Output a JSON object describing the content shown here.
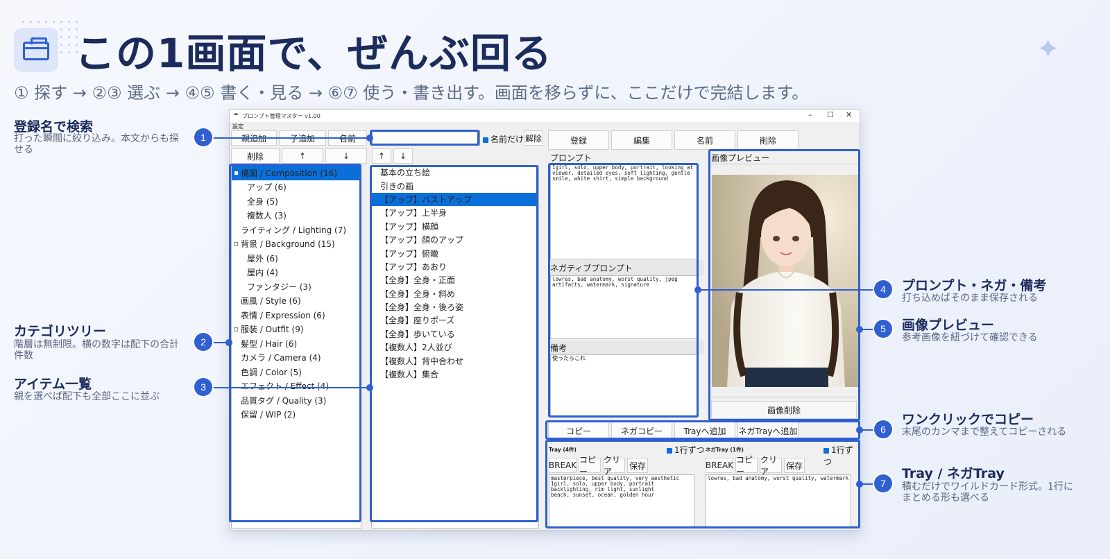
{
  "header": {
    "title": "この1画面で、ぜんぶ回る",
    "subtitle": "① 探す → ②③ 選ぶ → ④⑤ 書く・見る → ⑥⑦ 使う・書き出す。画面を移らずに、ここだけで完結します。"
  },
  "annotations": {
    "left": [
      {
        "num": "1",
        "title": "登録名で検索",
        "desc": "打った瞬間に絞り込み。本文からも探せる"
      },
      {
        "num": "2",
        "title": "カテゴリツリー",
        "desc": "階層は無制限。横の数字は配下の合計件数"
      },
      {
        "num": "3",
        "title": "アイテム一覧",
        "desc": "親を選べば配下も全部ここに並ぶ"
      }
    ],
    "right": [
      {
        "num": "4",
        "title": "プロンプト・ネガ・備考",
        "desc": "打ち込めばそのまま保存される"
      },
      {
        "num": "5",
        "title": "画像プレビュー",
        "desc": "参考画像を紐づけて確認できる"
      },
      {
        "num": "6",
        "title": "ワンクリックでコピー",
        "desc": "末尾のカンマまで整えてコピーされる"
      },
      {
        "num": "7",
        "title": "Tray / ネガTray",
        "desc": "積むだけでワイルドカード形式。1行にまとめる形も選べる"
      }
    ]
  },
  "app": {
    "window_title": "プロンプト管理マスター  v1.00",
    "menu": "設定",
    "window_controls": [
      "–",
      "☐",
      "✕"
    ],
    "toolbar1": [
      "親追加",
      "子追加",
      "名前"
    ],
    "toolbar2": [
      "削除",
      "↑",
      "↓"
    ],
    "list_toolbar": [
      "↑",
      "↓"
    ],
    "search_value": "",
    "name_only_label": "名前だけ",
    "clear_label": "解除",
    "actions": [
      "登録",
      "編集",
      "名前",
      "削除"
    ],
    "tree": [
      {
        "label": "構図 / Composition (16)",
        "level": 0,
        "selected": true,
        "expanded": true
      },
      {
        "label": "アップ (6)",
        "level": 1
      },
      {
        "label": "全身 (5)",
        "level": 1
      },
      {
        "label": "複数人 (3)",
        "level": 1
      },
      {
        "label": "ライティング / Lighting (7)",
        "level": 0
      },
      {
        "label": "背景 / Background (15)",
        "level": 0,
        "expanded": true
      },
      {
        "label": "屋外 (6)",
        "level": 1
      },
      {
        "label": "屋内 (4)",
        "level": 1
      },
      {
        "label": "ファンタジー (3)",
        "level": 1
      },
      {
        "label": "画風 / Style (6)",
        "level": 0
      },
      {
        "label": "表情 / Expression (6)",
        "level": 0
      },
      {
        "label": "服装 / Outfit (9)",
        "level": 0,
        "collapsed": true
      },
      {
        "label": "髪型 / Hair (6)",
        "level": 0
      },
      {
        "label": "カメラ / Camera (4)",
        "level": 0
      },
      {
        "label": "色調 / Color (5)",
        "level": 0
      },
      {
        "label": "エフェクト / Effect (4)",
        "level": 0
      },
      {
        "label": "品質タグ / Quality (3)",
        "level": 0
      },
      {
        "label": "保留 / WIP (2)",
        "level": 0
      }
    ],
    "items": [
      {
        "label": "基本の立ち絵"
      },
      {
        "label": "引きの画"
      },
      {
        "label": "【アップ】バストアップ",
        "selected": true
      },
      {
        "label": "【アップ】上半身"
      },
      {
        "label": "【アップ】横顔"
      },
      {
        "label": "【アップ】顔のアップ"
      },
      {
        "label": "【アップ】俯瞰"
      },
      {
        "label": "【アップ】あおり"
      },
      {
        "label": "【全身】全身・正面"
      },
      {
        "label": "【全身】全身・斜め"
      },
      {
        "label": "【全身】全身・後ろ姿"
      },
      {
        "label": "【全身】座りポーズ"
      },
      {
        "label": "【全身】歩いている"
      },
      {
        "label": "【複数人】2人並び"
      },
      {
        "label": "【複数人】背中合わせ"
      },
      {
        "label": "【複数人】集合"
      }
    ],
    "prompt_label": "プロンプト",
    "prompt_text": "1girl, solo, upper body, portrait, looking at\nviewer, detailed eyes, soft lighting, gentle\nsmile, white shirt, simple background",
    "neg_label": "ネガティブプロンプト",
    "neg_text": "lowres, bad anatomy, worst quality, jpeg\nartifacts, watermark, signature",
    "notes_label": "備考",
    "notes_text": "使ったらこれ",
    "preview_label": "画像プレビュー",
    "delete_image_label": "画像削除",
    "copy_buttons": [
      "コピー",
      "ネガコピー",
      "Trayへ追加",
      "ネガTrayへ追加"
    ],
    "tray": {
      "label": "Tray (4件)",
      "one_line_label": "1行ずつ",
      "buttons": [
        "BREAK",
        "コピー",
        "クリア",
        "保存"
      ],
      "text": "masterpiece, best quality, very aesthetic\n1girl, solo, upper body, portrait\nbacklighting, rim light, sunlight\nbeach, sunset, ocean, golden hour"
    },
    "neg_tray": {
      "label": "ネガTray (1件)",
      "one_line_label": "1行ずつ",
      "buttons": [
        "BREAK",
        "コピー",
        "クリア",
        "保存"
      ],
      "text": "lowres, bad anatomy, worst quality, watermark"
    }
  },
  "colors": {
    "accent": "#2f5fd0",
    "selection": "#0a6fd8",
    "title": "#1b2b5c"
  }
}
